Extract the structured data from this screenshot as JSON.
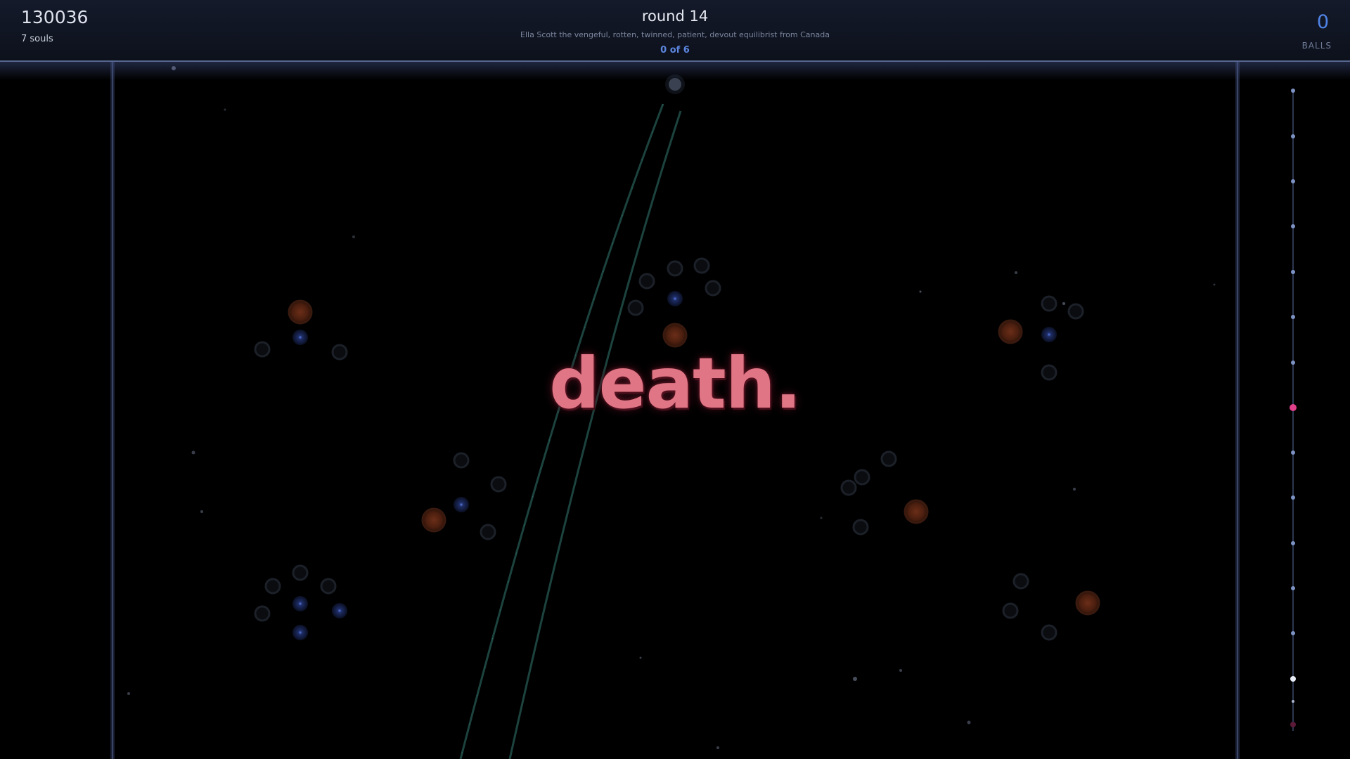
{
  "hud": {
    "score": "130036",
    "souls": "7 souls",
    "round": "round 14",
    "character": "Ella Scott the vengeful, rotten, twinned, patient, devout equilibrist from Canada",
    "progress": "0 of 6",
    "balls_count": "0",
    "balls_label": "BALLS"
  },
  "message": "death.",
  "colors": {
    "background": "#000000",
    "hud_bg": "#11161f",
    "accent_blue": "#4f83e6",
    "death_text": "#e07585",
    "peg_orange": "#8a3a1c",
    "peg_blue": "#223a7a",
    "marker_pink": "#e0408a"
  }
}
